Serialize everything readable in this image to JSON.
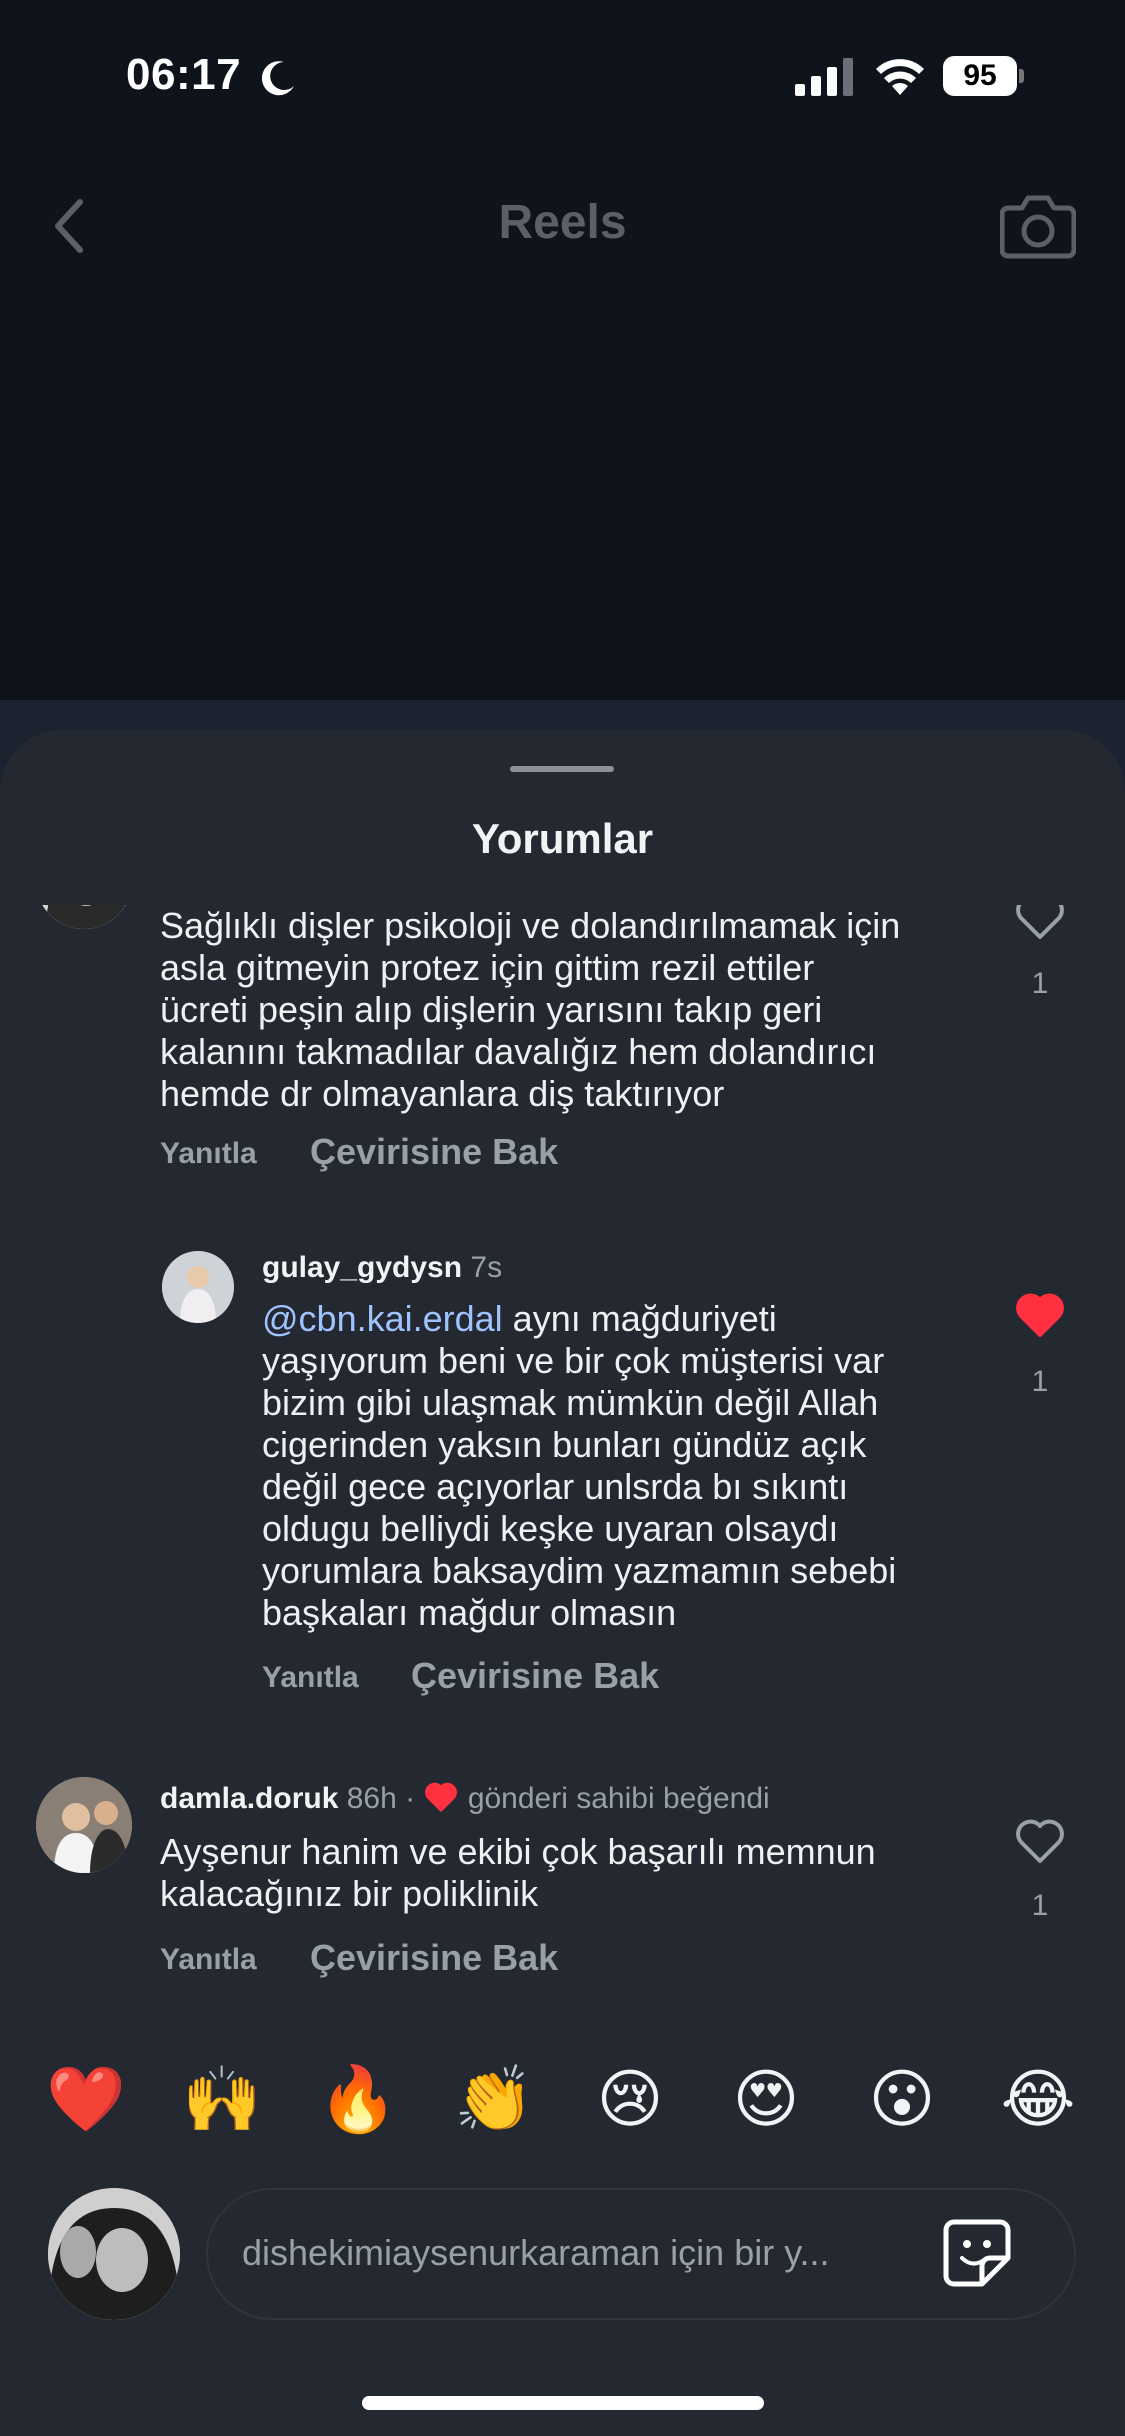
{
  "status_bar": {
    "time": "06:17",
    "battery": "95"
  },
  "header": {
    "title": "Reels"
  },
  "sheet": {
    "title": "Yorumlar"
  },
  "comments": [
    {
      "lines": [
        "Sağlıklı dişler psikoloji ve dolandırılmamak için",
        "asla gitmeyin  protez için gittim rezil ettiler",
        "ücreti peşin alıp dişlerin yarısını takıp geri",
        "kalanını takmadılar davalığız hem dolandırıcı",
        "hemde dr olmayanlara diş taktırıyor"
      ],
      "reply_label": "Yanıtla",
      "translate_label": "Çevirisine Bak",
      "like_count": "1",
      "liked": false
    },
    {
      "username": "gulay_gydysn",
      "time": "7s",
      "mention": "@cbn.kai.erdal",
      "first_line_rest": " aynı mağduriyeti",
      "lines": [
        "yaşıyorum beni ve  bir çok müşterisi var",
        "bizim gibi ulaşmak mümkün değil  Allah",
        "cigerinden yaksın bunları  gündüz açık",
        "değil gece  açıyorlar  unlsrda bı sıkıntı",
        "oldugu belliydi  keşke  uyaran olsaydı",
        "yorumlara baksaydim yazmamın sebebi",
        "başkaları mağdur olmasın"
      ],
      "reply_label": "Yanıtla",
      "translate_label": "Çevirisine Bak",
      "like_count": "1",
      "liked": true
    },
    {
      "username": "damla.doruk",
      "time": "86h",
      "separator": "·",
      "owner_liked": "gönderi sahibi beğendi",
      "lines": [
        "Ayşenur  hanim ve ekibi çok  başarılı  memnun",
        "kalacağınız  bir poliklinik"
      ],
      "reply_label": "Yanıtla",
      "translate_label": "Çevirisine Bak",
      "like_count": "1",
      "liked": false
    }
  ],
  "emoji_bar": [
    "❤️",
    "🙌",
    "🔥",
    "👏",
    "😢",
    "😍",
    "😮",
    "😂"
  ],
  "composer": {
    "placeholder": "dishekimiaysenurkaraman için bir y..."
  },
  "colors": {
    "sheet_bg": "#242830",
    "liked_heart": "#ff3040",
    "mention": "#9fc3ff",
    "muted_text": "#9aa0a8"
  }
}
